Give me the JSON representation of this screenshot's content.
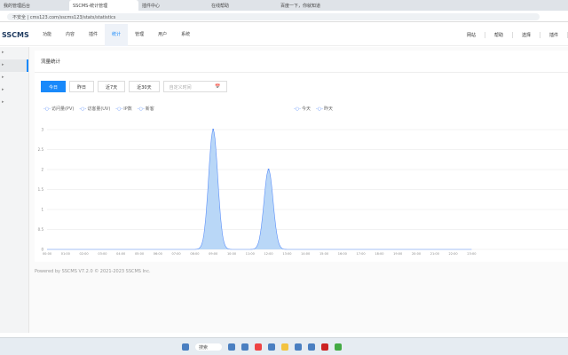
{
  "browser": {
    "tabs": [
      "我的管理后台",
      "SSCMS-统计管理",
      "插件中心",
      "在线帮助",
      "百度一下，你就知道"
    ],
    "address": "不安全 | cms123.com/sscms123/stats/statistics"
  },
  "topnav": {
    "logo": "SSCMS",
    "items": [
      "功能",
      "内容",
      "插件",
      "统计",
      "管理",
      "用户",
      "系统"
    ],
    "active": 3,
    "right": [
      "网站",
      "帮助",
      "选择",
      "插件"
    ]
  },
  "sidebar": {
    "items": [
      "",
      "",
      "",
      "",
      ""
    ]
  },
  "page": {
    "title": "流量统计",
    "buttons": [
      "今日",
      "昨日",
      "近7天",
      "近30天"
    ],
    "date_placeholder": "自定义时间",
    "calendar_icon": "📅",
    "legend_left": [
      "访问量(PV)",
      "访客量(UV)",
      "IP数",
      "新客"
    ],
    "legend_right": [
      "今天",
      "昨天"
    ]
  },
  "chart_data": {
    "type": "area",
    "categories": [
      "00:00",
      "01:00",
      "02:00",
      "03:00",
      "04:00",
      "05:00",
      "06:00",
      "07:00",
      "08:00",
      "09:00",
      "10:00",
      "11:00",
      "12:00",
      "13:00",
      "14:00",
      "15:00",
      "16:00",
      "17:00",
      "18:00",
      "19:00",
      "20:00",
      "21:00",
      "22:00",
      "23:00"
    ],
    "series": [
      {
        "values": [
          0,
          0,
          0,
          0,
          0,
          0,
          0,
          0,
          0,
          3,
          0,
          0,
          2,
          0,
          0,
          0,
          0,
          0,
          0,
          0,
          0,
          0,
          0,
          0
        ]
      }
    ],
    "ylim": [
      0,
      3
    ],
    "yticks": [
      "0",
      "0.5",
      "1",
      "1.5",
      "2",
      "2.5",
      "3"
    ],
    "grid": true,
    "color": "#5b8ff9",
    "fill": "#b9d7f7"
  },
  "footer": "Powered by SSCMS V7.2.0 © 2021-2023 SSCMS Inc.",
  "taskbar": {
    "search": "搜索"
  }
}
